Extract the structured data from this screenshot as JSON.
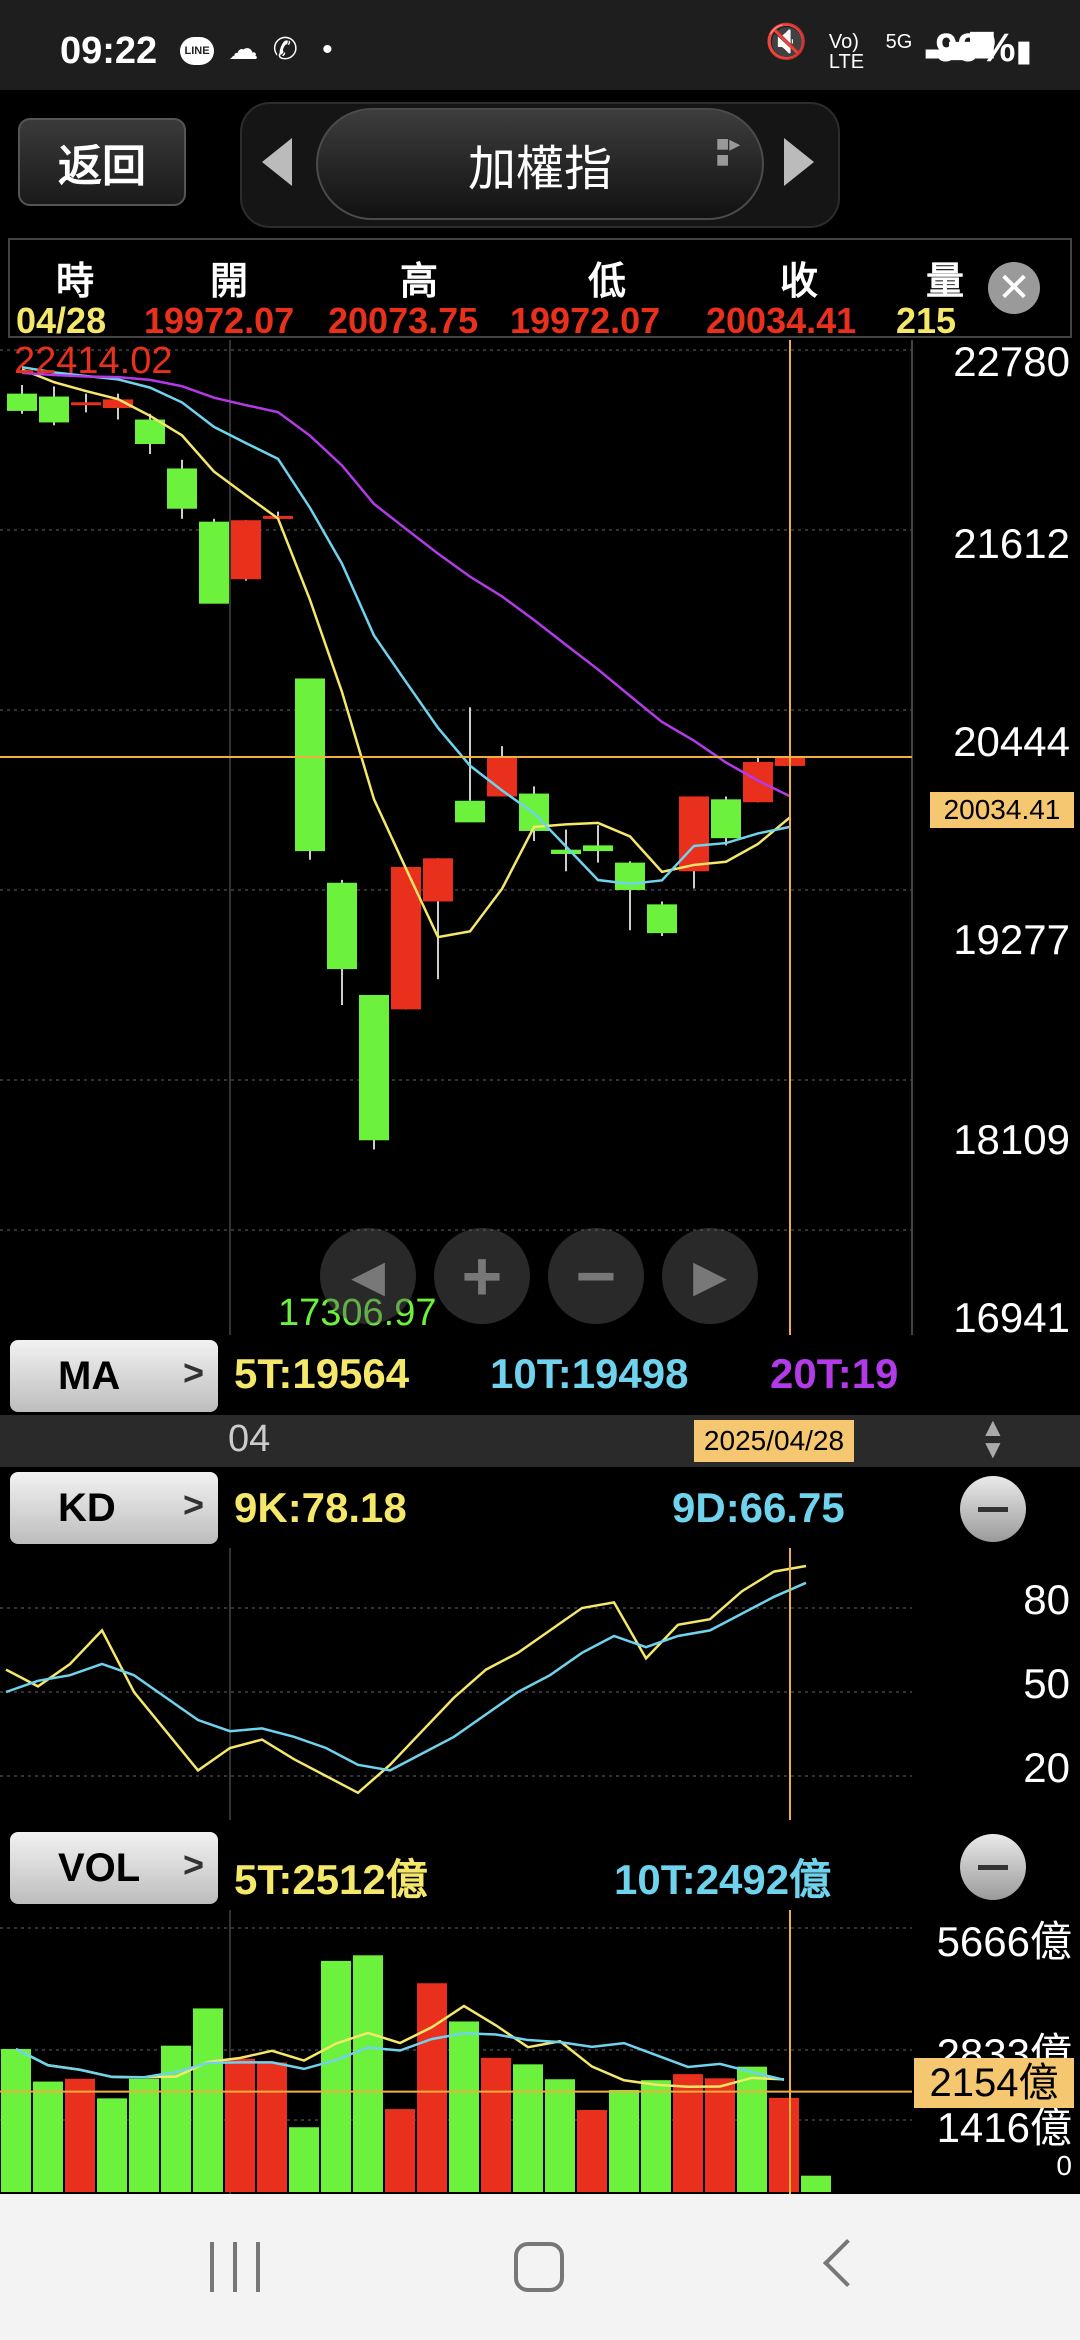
{
  "status": {
    "time": "09:22",
    "battery": "99%",
    "net_top": "Vo)",
    "net_bottom": "LTE",
    "gen": "5G"
  },
  "toolbar": {
    "back_label": "返回",
    "title": "加權指"
  },
  "ohlc": {
    "labels": [
      "時",
      "開",
      "高",
      "低",
      "收",
      "量"
    ],
    "values": [
      "04/28",
      "19972.07",
      "20073.75",
      "19972.07",
      "20034.41",
      "215"
    ]
  },
  "main_chart": {
    "high_label": "22414.02",
    "low_label": "17306.97",
    "price_axis": [
      "22780",
      "21612",
      "20444",
      "19277",
      "18109",
      "16941"
    ],
    "current_price": "20034.41"
  },
  "ma": {
    "button": "MA",
    "v5": "5T:19564",
    "v10": "10T:19498",
    "v20": "20T:19"
  },
  "date_row": {
    "month": "04",
    "date": "2025/04/28"
  },
  "kd": {
    "button": "KD",
    "k": "9K:78.18",
    "d": "9D:66.75",
    "axis": [
      "80",
      "50",
      "20"
    ]
  },
  "vol": {
    "button": "VOL",
    "v5": "5T:2512億",
    "v10": "10T:2492億",
    "axis": [
      "5666億",
      "2833億",
      "1416億",
      "0"
    ],
    "current": "2154億"
  },
  "colors": {
    "up": "#e8301c",
    "down": "#6cf23c",
    "ma5": "#f5e76a",
    "ma10": "#6fd3ee",
    "ma20": "#b33ae8",
    "crosshair": "#f0b040"
  },
  "candles": [
    {
      "o": 22560,
      "h": 22620,
      "l": 22420,
      "c": 22440
    },
    {
      "o": 22540,
      "h": 22610,
      "l": 22340,
      "c": 22360
    },
    {
      "o": 22480,
      "h": 22560,
      "l": 22430,
      "c": 22500
    },
    {
      "o": 22460,
      "h": 22560,
      "l": 22380,
      "c": 22520
    },
    {
      "o": 22380,
      "h": 22420,
      "l": 22140,
      "c": 22210
    },
    {
      "o": 22040,
      "h": 22100,
      "l": 21690,
      "c": 21760
    },
    {
      "o": 21670,
      "h": 21690,
      "l": 21110,
      "c": 21100
    },
    {
      "o": 21270,
      "h": 21680,
      "l": 21260,
      "c": 21680
    },
    {
      "o": 21700,
      "h": 21740,
      "l": 21690,
      "c": 21710
    },
    {
      "o": 20580,
      "h": 20580,
      "l": 19320,
      "c": 19380
    },
    {
      "o": 19160,
      "h": 19180,
      "l": 18310,
      "c": 18560
    },
    {
      "o": 18380,
      "h": 18380,
      "l": 17306,
      "c": 17370
    },
    {
      "o": 18280,
      "h": 19270,
      "l": 18280,
      "c": 19270
    },
    {
      "o": 19030,
      "h": 19330,
      "l": 18490,
      "c": 19330
    },
    {
      "o": 19730,
      "h": 20380,
      "l": 19730,
      "c": 19580
    },
    {
      "o": 19760,
      "h": 20110,
      "l": 19760,
      "c": 20040
    },
    {
      "o": 19780,
      "h": 19830,
      "l": 19450,
      "c": 19520
    },
    {
      "o": 19390,
      "h": 19530,
      "l": 19240,
      "c": 19360
    },
    {
      "o": 19420,
      "h": 19560,
      "l": 19300,
      "c": 19380
    },
    {
      "o": 19300,
      "h": 19310,
      "l": 18830,
      "c": 19110
    },
    {
      "o": 19010,
      "h": 19030,
      "l": 18790,
      "c": 18810
    },
    {
      "o": 19240,
      "h": 19460,
      "l": 19120,
      "c": 19760
    },
    {
      "o": 19740,
      "h": 19760,
      "l": 19420,
      "c": 19470
    },
    {
      "o": 19720,
      "h": 20040,
      "l": 19720,
      "c": 20000
    },
    {
      "o": 19972.07,
      "h": 20073.75,
      "l": 19972.07,
      "c": 20034.41
    }
  ],
  "volumes": [
    3070,
    2370,
    2430,
    2010,
    2430,
    3140,
    3940,
    2860,
    2780,
    1390,
    4960,
    5080,
    1780,
    4480,
    3660,
    2880,
    2740,
    2420,
    1760,
    2190,
    2400,
    2530,
    2440,
    2690,
    2020,
    350
  ]
}
